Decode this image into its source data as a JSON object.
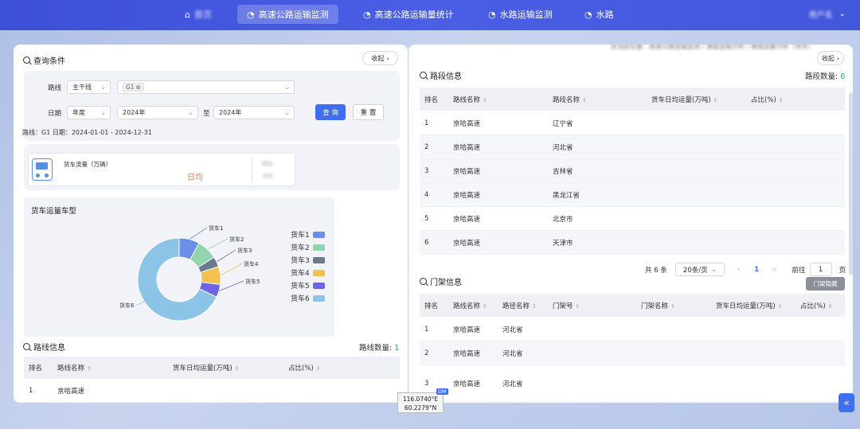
{
  "nav": {
    "items": [
      {
        "icon": "⌂",
        "label": "首页"
      },
      {
        "icon": "◔",
        "label": "高速公路运输监测"
      },
      {
        "icon": "◔",
        "label": "高速公路运输量统计"
      },
      {
        "icon": "◔",
        "label": "水路运输监测"
      },
      {
        "icon": "◔",
        "label": "水路"
      }
    ],
    "user": "用户名"
  },
  "left": {
    "query_title": "查询条件",
    "collapse_label": "收起",
    "route_label": "路线",
    "route_type": "主干线",
    "route_tag": "G1",
    "date_label": "日期",
    "date_type": "年度",
    "date_from": "2024年",
    "date_to_sep": "至",
    "date_to": "2024年",
    "query_btn": "查 询",
    "reset_btn": "重 置",
    "summary": "路线：G1   日期：2024-01-01 - 2024-12-31",
    "stat": {
      "title": "货车流量（万辆）",
      "daily_label": "日均",
      "yoy_label": "同比",
      "ratio_label": "占比"
    },
    "chart_title": "货车运量车型",
    "route_info_title": "路线信息",
    "route_count_label": "路线数量: ",
    "route_count": "1",
    "route_table": {
      "headers": [
        "排名",
        "路线名称",
        "货车日均运量(万吨)",
        "占比(%)"
      ],
      "rows": [
        [
          "1",
          "京哈高速",
          "",
          ""
        ]
      ]
    }
  },
  "chart_data": {
    "type": "pie",
    "donut": true,
    "title": "货车运量车型",
    "categories": [
      "货车1",
      "货车2",
      "货车3",
      "货车4",
      "货车5",
      "货车6"
    ],
    "values": [
      8,
      8,
      4,
      7,
      5,
      68
    ],
    "colors": [
      "#6b8ee6",
      "#93d3ad",
      "#6b7a91",
      "#f2c14e",
      "#6f63e6",
      "#8cc4e8"
    ],
    "legend_position": "right"
  },
  "right": {
    "breadcrumb": "您当前位置：高速公路运输监测 / 通道运输分析 / 通道运量分析（货车）",
    "collapse_label": "收起",
    "segment_title": "路段信息",
    "segment_count_label": "路段数量: ",
    "segment_count": "6",
    "segment_table": {
      "headers": [
        "排名",
        "路线名称",
        "路段名称",
        "货车日均运量(万吨)",
        "占比(%)"
      ],
      "rows": [
        [
          "1",
          "京哈高速",
          "辽宁省"
        ],
        [
          "2",
          "京哈高速",
          "河北省"
        ],
        [
          "3",
          "京哈高速",
          "吉林省"
        ],
        [
          "4",
          "京哈高速",
          "黑龙江省"
        ],
        [
          "5",
          "京哈高速",
          "北京市"
        ],
        [
          "6",
          "京哈高速",
          "天津市"
        ]
      ]
    },
    "pager": {
      "total": "共 6 条",
      "page_size": "20条/页",
      "prev": "‹",
      "current": "1",
      "next": "›",
      "goto_label": "前往",
      "goto_value": "1",
      "page_unit": "页"
    },
    "gantry_title": "门架信息",
    "gantry_hide_btn": "门架隐藏",
    "gantry_table": {
      "headers": [
        "排名",
        "路线名称",
        "路径名称",
        "门架号",
        "门架名称",
        "货车日均运量(万吨)",
        "占比(%)"
      ],
      "rows": [
        [
          "1",
          "京哈高速",
          "河北省"
        ],
        [
          "2",
          "京哈高速",
          "河北省"
        ],
        [
          "3",
          "京哈高速",
          "河北省"
        ]
      ]
    }
  },
  "map": {
    "lon": "116.0740°E",
    "lat": "60.2279°N",
    "badge": "DM"
  },
  "side_toggle": "«"
}
